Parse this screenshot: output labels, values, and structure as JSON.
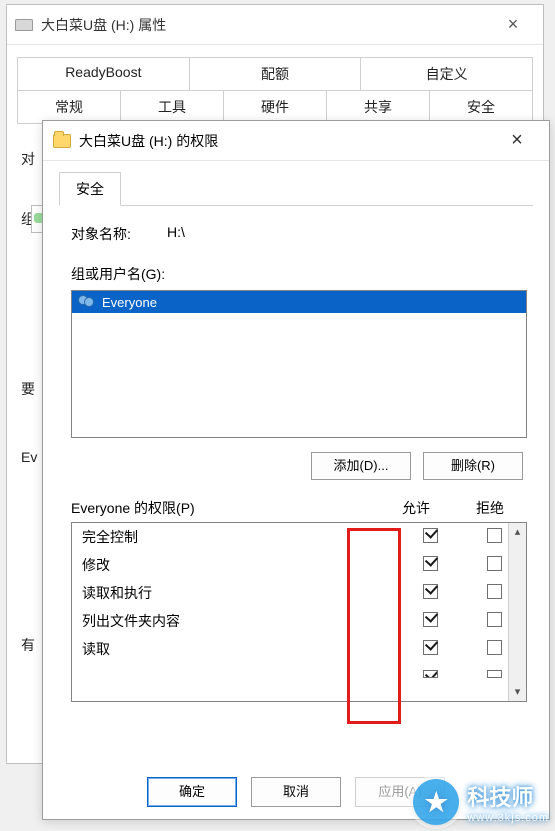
{
  "parent_window": {
    "title": "大白菜U盘 (H:) 属性",
    "close": "×",
    "tabs_row1": [
      "ReadyBoost",
      "配额",
      "自定义"
    ],
    "tabs_row2": [
      "常规",
      "工具",
      "硬件",
      "共享",
      "安全"
    ],
    "active_tab": "安全",
    "body_fragments": {
      "dui": "对",
      "zu": "组",
      "yao": "要",
      "ev": "Ev",
      "you": "有"
    }
  },
  "perm_dialog": {
    "title": "大白菜U盘 (H:) 的权限",
    "close": "×",
    "tab": "安全",
    "object_name_label": "对象名称:",
    "object_name_value": "H:\\",
    "groups_label": "组或用户名(G):",
    "users": [
      {
        "name": "Everyone",
        "selected": true
      }
    ],
    "btn_add": "添加(D)...",
    "btn_remove": "删除(R)",
    "perm_for_label": "Everyone 的权限(P)",
    "col_allow": "允许",
    "col_deny": "拒绝",
    "rows": [
      {
        "label": "完全控制",
        "allow": true,
        "deny": false
      },
      {
        "label": "修改",
        "allow": true,
        "deny": false
      },
      {
        "label": "读取和执行",
        "allow": true,
        "deny": false
      },
      {
        "label": "列出文件夹内容",
        "allow": true,
        "deny": false
      },
      {
        "label": "读取",
        "allow": true,
        "deny": false
      }
    ],
    "btn_ok": "确定",
    "btn_cancel": "取消",
    "btn_apply": "应用(A)"
  },
  "watermark": {
    "brand": "科技师",
    "url": "www.3kjs.com"
  }
}
